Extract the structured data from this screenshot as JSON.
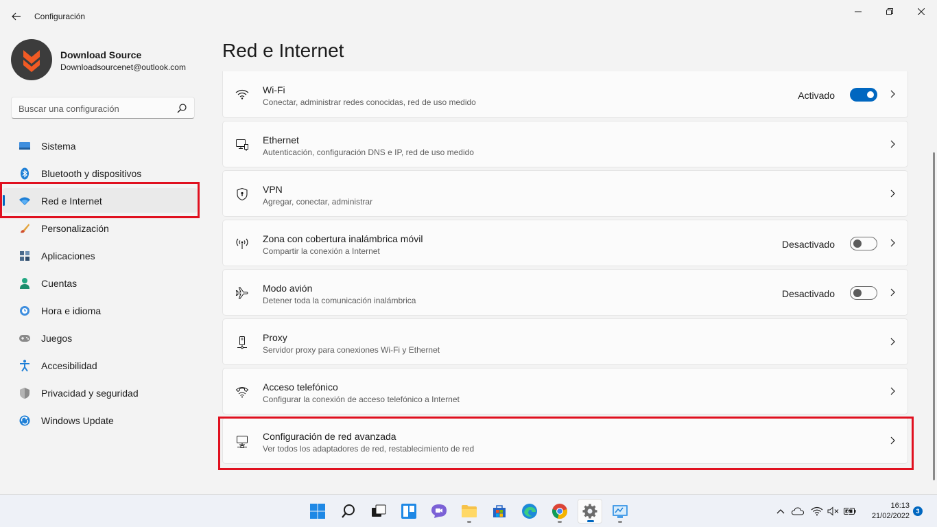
{
  "window": {
    "title": "Configuración"
  },
  "profile": {
    "name": "Download Source",
    "email": "Downloadsourcenet@outlook.com"
  },
  "search": {
    "placeholder": "Buscar una configuración"
  },
  "sidebar": {
    "items": [
      {
        "label": "Sistema",
        "icon": "monitor-icon"
      },
      {
        "label": "Bluetooth y dispositivos",
        "icon": "bluetooth-icon"
      },
      {
        "label": "Red e Internet",
        "icon": "wifi-icon",
        "active": true
      },
      {
        "label": "Personalización",
        "icon": "brush-icon"
      },
      {
        "label": "Aplicaciones",
        "icon": "apps-icon"
      },
      {
        "label": "Cuentas",
        "icon": "person-icon"
      },
      {
        "label": "Hora e idioma",
        "icon": "globe-clock-icon"
      },
      {
        "label": "Juegos",
        "icon": "gamepad-icon"
      },
      {
        "label": "Accesibilidad",
        "icon": "accessibility-icon"
      },
      {
        "label": "Privacidad y seguridad",
        "icon": "shield-icon"
      },
      {
        "label": "Windows Update",
        "icon": "update-icon"
      }
    ]
  },
  "main": {
    "title": "Red e Internet",
    "cards": [
      {
        "title": "Wi-Fi",
        "desc": "Conectar, administrar redes conocidas, red de uso medido",
        "status": "Activado",
        "toggle": "on",
        "icon": "wifi-icon"
      },
      {
        "title": "Ethernet",
        "desc": "Autenticación, configuración DNS e IP, red de uso medido",
        "icon": "ethernet-icon"
      },
      {
        "title": "VPN",
        "desc": "Agregar, conectar, administrar",
        "icon": "vpn-shield-icon"
      },
      {
        "title": "Zona con cobertura inalámbrica móvil",
        "desc": "Compartir la conexión a Internet",
        "status": "Desactivado",
        "toggle": "off",
        "icon": "hotspot-icon"
      },
      {
        "title": "Modo avión",
        "desc": "Detener toda la comunicación inalámbrica",
        "status": "Desactivado",
        "toggle": "off",
        "icon": "airplane-icon"
      },
      {
        "title": "Proxy",
        "desc": "Servidor proxy para conexiones Wi-Fi y Ethernet",
        "icon": "proxy-icon"
      },
      {
        "title": "Acceso telefónico",
        "desc": "Configurar la conexión de acceso telefónico a Internet",
        "icon": "dialup-icon"
      },
      {
        "title": "Configuración de red avanzada",
        "desc": "Ver todos los adaptadores de red, restablecimiento de red",
        "icon": "network-pc-icon"
      }
    ]
  },
  "taskbar": {
    "time": "16:13",
    "date": "21/02/2022",
    "notifications": "3"
  },
  "colors": {
    "accent": "#0067c0",
    "highlight": "#e0101f",
    "logo": "#f15a24"
  }
}
